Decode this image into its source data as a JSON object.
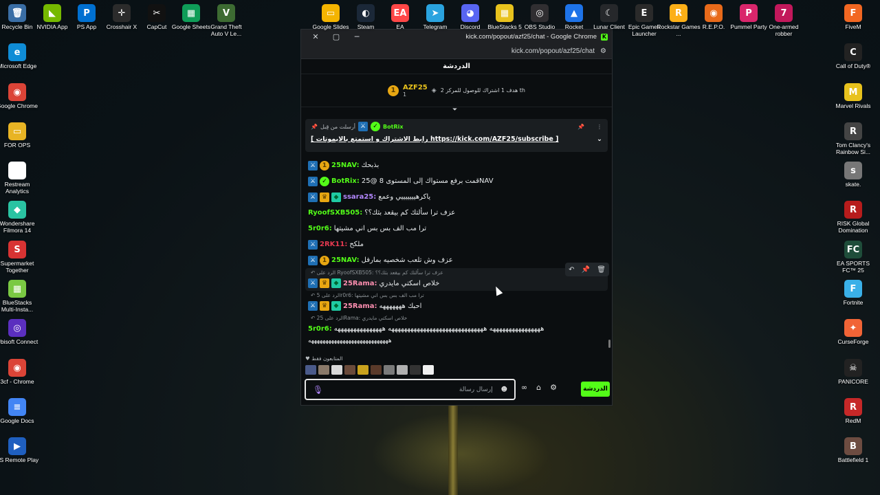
{
  "desktop": {
    "left_icons": [
      {
        "label": "Recycle Bin",
        "glyph": "🗑",
        "color": "#3a6ea5",
        "icon": "recycle-bin-icon"
      },
      {
        "label": "Microsoft Edge",
        "glyph": "e",
        "color": "#0f8cd6",
        "icon": "edge-icon"
      },
      {
        "label": "Google Chrome",
        "glyph": "◉",
        "color": "#db4437",
        "icon": "chrome-icon"
      },
      {
        "label": "FOR OPS",
        "glyph": "▭",
        "color": "#e8b424",
        "icon": "folder-icon"
      },
      {
        "label": "Restream Analytics",
        "glyph": "R",
        "color": "#ffffff",
        "icon": "restream-icon"
      },
      {
        "label": "Wondershare Filmora 14",
        "glyph": "◆",
        "color": "#2ac3a2",
        "icon": "filmora-icon"
      },
      {
        "label": "Supermarket Together",
        "glyph": "S",
        "color": "#d83333",
        "icon": "supermarket-icon"
      },
      {
        "label": "BlueStacks Multi-Insta...",
        "glyph": "▦",
        "color": "#7ac943",
        "icon": "bluestacks-multi-icon"
      },
      {
        "label": "Ubisoft Connect",
        "glyph": "◎",
        "color": "#5b2fbf",
        "icon": "ubisoft-icon"
      },
      {
        "label": "3cf - Chrome",
        "glyph": "◉",
        "color": "#db4437",
        "icon": "chrome-profile-icon"
      },
      {
        "label": "Google Docs",
        "glyph": "≡",
        "color": "#4285f4",
        "icon": "docs-icon"
      },
      {
        "label": "PS Remote Play",
        "glyph": "▶",
        "color": "#1f5fbf",
        "icon": "ps-remote-icon"
      }
    ],
    "top_icons": [
      {
        "label": "NVIDIA App",
        "glyph": "◣",
        "color": "#76b900",
        "icon": "nvidia-icon"
      },
      {
        "label": "PS App",
        "glyph": "P",
        "color": "#0070d1",
        "icon": "ps-app-icon"
      },
      {
        "label": "Crosshair X",
        "glyph": "✛",
        "color": "#2b2b2b",
        "icon": "crosshair-icon"
      },
      {
        "label": "CapCut",
        "glyph": "✂",
        "color": "#111111",
        "icon": "capcut-icon"
      },
      {
        "label": "Google Sheets",
        "glyph": "▦",
        "color": "#0f9d58",
        "icon": "sheets-icon"
      },
      {
        "label": "Grand Theft Auto V Le...",
        "glyph": "V",
        "color": "#3d6b32",
        "icon": "gta-icon"
      },
      {
        "label": "Google Slides",
        "glyph": "▭",
        "color": "#f4b400",
        "icon": "slides-icon"
      },
      {
        "label": "Steam",
        "glyph": "◐",
        "color": "#1b2838",
        "icon": "steam-icon"
      },
      {
        "label": "EA",
        "glyph": "EA",
        "color": "#ff4747",
        "icon": "ea-icon"
      },
      {
        "label": "Telegram",
        "glyph": "➤",
        "color": "#2aa3df",
        "icon": "telegram-icon"
      },
      {
        "label": "Discord",
        "glyph": "◕",
        "color": "#5865f2",
        "icon": "discord-icon"
      },
      {
        "label": "BlueStacks 5",
        "glyph": "▦",
        "color": "#e8c21d",
        "icon": "bluestacks-icon"
      },
      {
        "label": "OBS Studio",
        "glyph": "◎",
        "color": "#302e31",
        "icon": "obs-icon"
      },
      {
        "label": "Rocket",
        "glyph": "▲",
        "color": "#1e73e8",
        "icon": "rocket-icon"
      },
      {
        "label": "Lunar Client",
        "glyph": "☾",
        "color": "#26282b",
        "icon": "lunar-icon"
      },
      {
        "label": "Epic Games Launcher",
        "glyph": "E",
        "color": "#2a2a2a",
        "icon": "epic-icon"
      },
      {
        "label": "Rockstar Games ...",
        "glyph": "R",
        "color": "#fcaf17",
        "icon": "rockstar-icon"
      },
      {
        "label": "R.E.P.O.",
        "glyph": "◉",
        "color": "#e86a1a",
        "icon": "repo-icon"
      },
      {
        "label": "Pummel Party",
        "glyph": "P",
        "color": "#d9266b",
        "icon": "pummel-icon"
      },
      {
        "label": "One-armed robber",
        "glyph": "7",
        "color": "#c2185b",
        "icon": "robber-icon"
      }
    ],
    "right_icons": [
      {
        "label": "FiveM",
        "glyph": "F",
        "color": "#f26722",
        "icon": "fivem-icon"
      },
      {
        "label": "Call of Duty®",
        "glyph": "C",
        "color": "#222222",
        "icon": "cod-icon"
      },
      {
        "label": "Marvel Rivals",
        "glyph": "M",
        "color": "#e8c21d",
        "icon": "marvel-icon"
      },
      {
        "label": "Tom Clancy's Rainbow Si...",
        "glyph": "R",
        "color": "#444444",
        "icon": "rainbow-icon"
      },
      {
        "label": "skate.",
        "glyph": "s",
        "color": "#777777",
        "icon": "skate-icon"
      },
      {
        "label": "RISK Global Domination",
        "glyph": "R",
        "color": "#b71c1c",
        "icon": "risk-icon"
      },
      {
        "label": "EA SPORTS FC™ 25",
        "glyph": "FC",
        "color": "#1f4d3a",
        "icon": "fc25-icon"
      },
      {
        "label": "Fortnite",
        "glyph": "F",
        "color": "#3ab0e8",
        "icon": "fortnite-icon"
      },
      {
        "label": "CurseForge",
        "glyph": "✦",
        "color": "#f16436",
        "icon": "curseforge-icon"
      },
      {
        "label": "PANICORE",
        "glyph": "☠",
        "color": "#222222",
        "icon": "panicore-icon"
      },
      {
        "label": "RedM",
        "glyph": "R",
        "color": "#c62828",
        "icon": "redm-icon"
      },
      {
        "label": "Battlefield 1",
        "glyph": "B",
        "color": "#6d4c41",
        "icon": "bf1-icon"
      }
    ]
  },
  "window": {
    "title": "kick.com/popout/azf25/chat - Google Chrome",
    "url": "kick.com/popout/azf25/chat",
    "close": "✕",
    "maximize": "▢",
    "minimize": "─"
  },
  "chat": {
    "header": "الدردشة",
    "goal": {
      "channel": "AZF25",
      "count": "1",
      "text": "هدف 1 اشتراك للوصول للمركز 2 th"
    },
    "pinned": {
      "pinned_by": "أرسلت من قِبل",
      "user": "BotRix",
      "link_text": "[ رابط الاشتراك و استمتع بالايموتات https://kick.com/AZF25/subscribe ]"
    },
    "messages": [
      {
        "user": "25NAV:",
        "text": "بذبحك",
        "color": "#53fc18",
        "badges": [
          "mod",
          "coin"
        ]
      },
      {
        "user": "BotRix:",
        "text": "قمت برفع مستواك إلى المستوى 8 @25NAV",
        "color": "#53fc18",
        "badges": [
          "mod",
          "bot"
        ]
      },
      {
        "user": "ssara25:",
        "text": "ياكرهيييييييي وعمع",
        "color": "#b388ff",
        "badges": [
          "mod",
          "crown",
          "vip"
        ]
      },
      {
        "user": "RyoofSXB505:",
        "text": "عزف ترا سألتك كم بيقعد بثك؟؟",
        "color": "#53fc18",
        "badges": []
      },
      {
        "user": "5r0r6:",
        "text": "ترا مب الف بس بس اني مشيتها",
        "color": "#53fc18",
        "badges": []
      },
      {
        "user": "2RK11:",
        "text": "ملكح",
        "color": "#e53950",
        "badges": [
          "mod"
        ]
      },
      {
        "user": "25NAV:",
        "text": "عزف وش تلعب شخصيه بمارفل",
        "color": "#53fc18",
        "badges": [
          "mod",
          "coin"
        ]
      }
    ],
    "reply1": {
      "ref": "الرد على RyoofSXB505: عزف ترا سألتك كم بيقعد بثك؟؟",
      "user": "25Rama:",
      "text": "خلاص اسكتي مايدري"
    },
    "reply2": {
      "ref": "الرد على 5r0r6: ترا مب الف بس بس اني مشيتها",
      "user": "25Rama:",
      "text": "احبك هههههههه"
    },
    "reply3": {
      "ref": "الرد على 25Rama: خلاص اسكتي مايدري",
      "user": "5r0r6:",
      "text": "ههههههههههههههههه ههههههههههههههههههههههههههههههه هههههههههههههههه"
    },
    "reply3_cont": "ههههههههههههههههههههههههههههه",
    "watchers_label": "المتابعون فقط",
    "input_placeholder": "إرسال رسالة",
    "send_label": "الدردشة"
  }
}
